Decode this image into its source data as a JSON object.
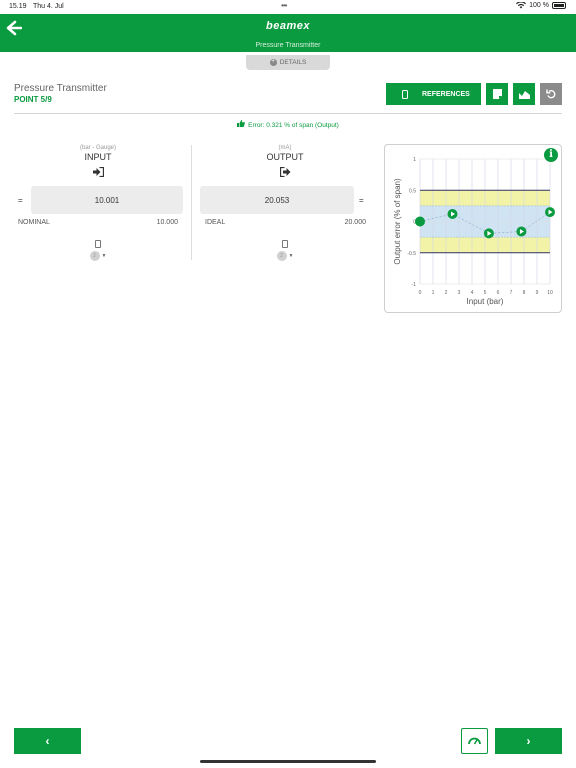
{
  "status_bar": {
    "time": "15.19",
    "date": "Thu 4. Jul",
    "battery": "100 %"
  },
  "header": {
    "logo": "beamex",
    "subtitle": "Pressure Transmitter"
  },
  "details_tab": {
    "label": "DETAILS"
  },
  "page": {
    "title": "Pressure Transmitter",
    "point": "POINT 5/9"
  },
  "toolbar": {
    "references_label": "REFERENCES"
  },
  "error_text": "Error: 0.321 % of span (Output)",
  "input": {
    "unit": "(bar - Gauge)",
    "heading": "INPUT",
    "value": "10.001",
    "label": "NOMINAL",
    "nominal": "10.000",
    "channel": "2",
    "equals": "="
  },
  "output": {
    "unit": "(mA)",
    "heading": "OUTPUT",
    "value": "20.053",
    "label": "IDEAL",
    "ideal": "20.000",
    "channel": "2",
    "equals": "="
  },
  "chart_data": {
    "type": "scatter",
    "xlabel": "Input (bar)",
    "ylabel": "Output error (% of span)",
    "x_ticks": [
      "0",
      "1",
      "2",
      "3",
      "4",
      "5",
      "6",
      "7",
      "8",
      "9",
      "10"
    ],
    "y_ticks": [
      "1",
      "0.5",
      "0",
      "-0.5",
      "-1"
    ],
    "xlim": [
      0,
      10
    ],
    "ylim": [
      -1,
      1
    ],
    "tolerance_bands": [
      0.5,
      0.25
    ],
    "points": [
      {
        "x": 0,
        "y": 0.0,
        "kind": "current"
      },
      {
        "x": 2.5,
        "y": 0.12,
        "kind": "up"
      },
      {
        "x": 5.3,
        "y": -0.19,
        "kind": "up"
      },
      {
        "x": 7.8,
        "y": -0.16,
        "kind": "up"
      },
      {
        "x": 10.0,
        "y": 0.15,
        "kind": "up"
      }
    ],
    "colors": {
      "band_outer": "#f3f3a8",
      "band_inner": "#cfe3f3",
      "point": "#0a9a3f",
      "limit": "#333366"
    }
  },
  "footer": {
    "prev_label": "‹",
    "next_label": "›"
  }
}
